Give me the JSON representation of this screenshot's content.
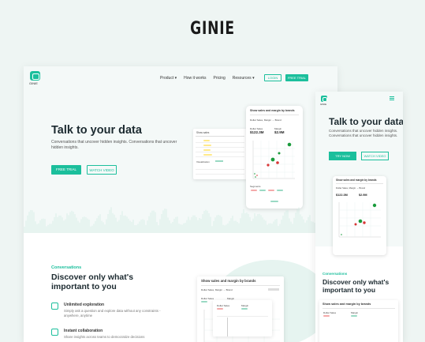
{
  "brand": "GINIE",
  "desktop": {
    "logo_text": "GINIE",
    "nav": [
      "Product",
      "How it works",
      "Pricing",
      "Resources"
    ],
    "login": "LOGIN",
    "free_trial_small": "FREE TRIAL",
    "hero_title": "Talk to your data",
    "hero_sub": "Conversations that uncover hidden insights. Conversations that uncover hidden insights.",
    "free_trial": "FREE TRIAL",
    "watch_video": "WATCH VIDEO",
    "phone_header": "Show sales and margin by brands",
    "phone_query": "Dollar Sales, Margin → Brand",
    "dollar_sales_label": "Dollar Sales",
    "dollar_sales_value": "$122.3M",
    "margin_label": "Margin",
    "margin_value": "$2.9M",
    "segments": "Segments",
    "side_title": "Show sales",
    "side_section": "Visualization",
    "card_header": "Show sales and margin by brands",
    "card_query": "Dollar Sales, Margin → Brand",
    "conv_label": "Conversations",
    "conv_title": "Discover only what's important to you",
    "features": [
      {
        "title": "Unlimited exploration",
        "desc": "Simply ask a question and explore data without any constraints - anywhere, anytime"
      },
      {
        "title": "Instant collaboration",
        "desc": "Share insights across teams to democratize decisions"
      }
    ]
  },
  "mobile": {
    "logo_text": "GINIE",
    "title": "Talk to your data",
    "sub": "Conversations that uncover hidden insights. Conversations that uncover hidden insights.",
    "try_now": "TRY NOW",
    "watch_video": "WATCH VIDEO",
    "phone_header": "Show sales and margin by brands",
    "phone_query": "Dollar Sales, Margin → Brand",
    "dollar_sales_value": "$122.3M",
    "margin_value": "$2.9M",
    "conv_label": "Conversations",
    "conv_title": "Discover only what's important to you",
    "card_header": "Show sales and margin by brands",
    "dollar_sales_label": "Dollar Sales",
    "margin_label": "Margin"
  },
  "colors": {
    "accent": "#1bbf9c",
    "background": "#eef5f3"
  }
}
